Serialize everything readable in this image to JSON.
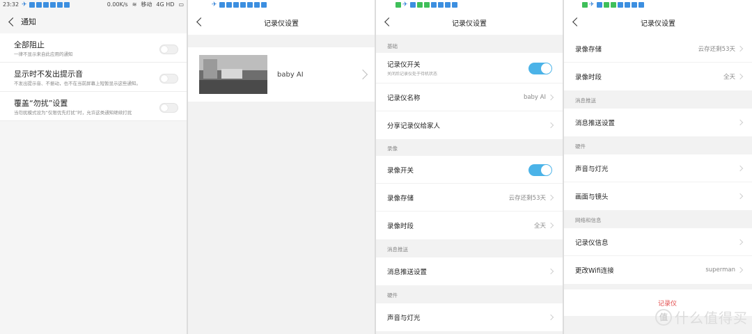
{
  "panel1": {
    "statusbar": {
      "time": "23:32",
      "speed": "0.00K/s",
      "carrier": "移动",
      "network": "4G HD"
    },
    "header": {
      "title": "通知"
    },
    "rows": [
      {
        "title": "全部阻止",
        "subtitle": "一律不显示来自此应用的通知"
      },
      {
        "title": "显示时不发出提示音",
        "subtitle": "不发出提示音、不振动，也不在当前屏幕上短暂显示这些通知。"
      },
      {
        "title": "覆盖“勿扰”设置",
        "subtitle": "当勿扰模式设为“仅限优先打扰”时，允许这类通知继续打扰"
      }
    ]
  },
  "panel2": {
    "header": {
      "title": "记录仪设置"
    },
    "device": {
      "name": "baby AI"
    }
  },
  "panel3": {
    "header": {
      "title": "记录仪设置"
    },
    "sections": {
      "basic": "基础",
      "record": "录像",
      "push": "消息推送",
      "hardware": "硬件"
    },
    "rows": {
      "power_label": "记录仪开关",
      "power_sub": "关闭后记录仪处于待机状态",
      "name_label": "记录仪名称",
      "name_value": "baby AI",
      "share_label": "分享记录仪给家人",
      "rec_switch_label": "录像开关",
      "storage_label": "录像存储",
      "storage_value": "云存还剩53天",
      "period_label": "录像时段",
      "period_value": "全天",
      "push_label": "消息推送设置",
      "sound_label": "声音与灯光"
    }
  },
  "panel4": {
    "header": {
      "title": "记录仪设置"
    },
    "sections": {
      "push": "消息推送",
      "hardware": "硬件",
      "network": "网络和信息"
    },
    "rows": {
      "storage_label": "录像存储",
      "storage_value": "云存还剩53天",
      "period_label": "录像时段",
      "period_value": "全天",
      "push_label": "消息推送设置",
      "sound_label": "声音与灯光",
      "lens_label": "画面与镜头",
      "info_label": "记录仪信息",
      "wifi_label": "更改Wifi连接",
      "wifi_value": "superman"
    },
    "watermark": {
      "red_text": "记录仪",
      "text": "什么值得买",
      "badge": "值"
    }
  }
}
